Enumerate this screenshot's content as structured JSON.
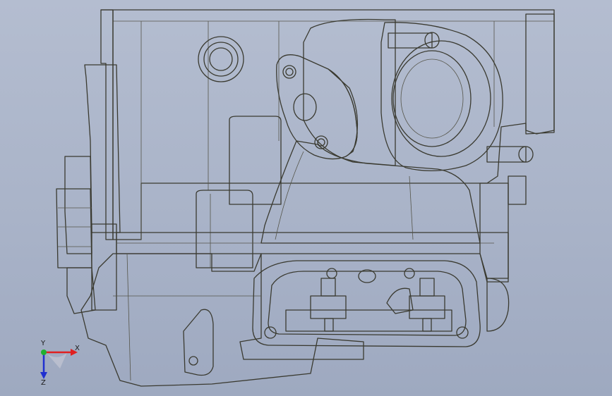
{
  "viewport": {
    "background_top": "#b4bdd0",
    "background_bottom": "#9ea9c0",
    "part_color": "#d9dac6"
  },
  "triad": {
    "x_label": "X",
    "y_label": "Y",
    "z_label": "Z",
    "x_color": "#e02020",
    "y_color": "#20b030",
    "z_color": "#2030d0"
  }
}
